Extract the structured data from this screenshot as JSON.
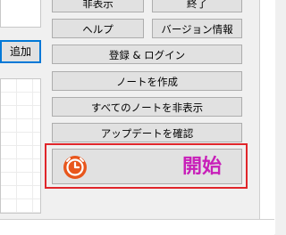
{
  "left_panel": {
    "add_button_label": "追加"
  },
  "buttons": {
    "hide": "非表示",
    "exit": "終了",
    "help": "ヘルプ",
    "version_info": "バージョン情報",
    "register_login": "登録 & ログイン",
    "create_note": "ノートを作成",
    "hide_all_notes": "すべてのノートを非表示",
    "check_updates": "アップデートを確認",
    "start": "開始"
  },
  "colors": {
    "highlight_frame": "#e0262b",
    "start_label": "#c81fb9",
    "start_icon": "#e8561c",
    "focus_border": "#0078d7"
  },
  "icons": {
    "start": "clock-icon"
  }
}
